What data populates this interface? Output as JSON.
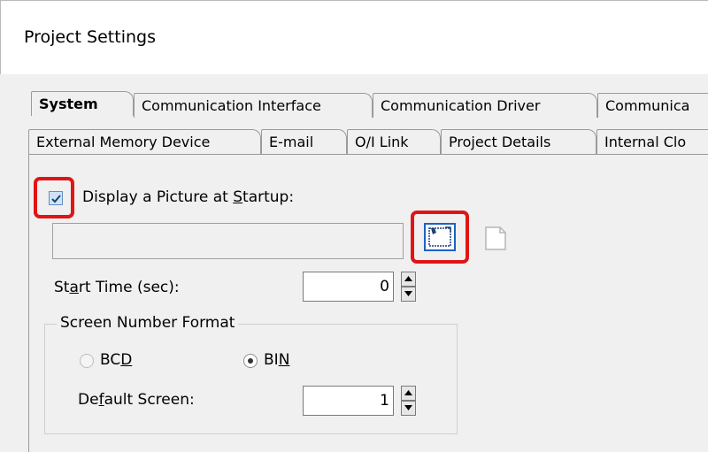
{
  "window": {
    "title": "Project Settings"
  },
  "tabs": {
    "row1": [
      "System",
      "Communication Interface",
      "Communication Driver",
      "Communica"
    ],
    "row2": [
      "External Memory Device",
      "E-mail",
      "O/I Link",
      "Project Details",
      "Internal Clo"
    ],
    "active": "System"
  },
  "startup_picture": {
    "checkbox_checked": true,
    "label_pre": "Display a Picture at ",
    "label_u": "S",
    "label_post": "tartup:",
    "path_value": ""
  },
  "start_time": {
    "label_pre": "St",
    "label_u": "a",
    "label_post": "rt Time (sec):",
    "value": "0"
  },
  "screen_number_format": {
    "legend": "Screen Number Format",
    "bcd": {
      "pre": "BC",
      "u": "D",
      "selected": false,
      "enabled": false
    },
    "bin": {
      "pre": "BI",
      "u": "N",
      "selected": true,
      "enabled": true
    },
    "selected": "BIN"
  },
  "default_screen": {
    "label_pre": "De",
    "label_u": "f",
    "label_post": "ault Screen:",
    "value": "1"
  },
  "icons": {
    "checkbox": "checkmark-icon",
    "browse": "open-file-icon",
    "clear": "blank-file-icon",
    "spin_up": "triangle-up-icon",
    "spin_down": "triangle-down-icon"
  },
  "colors": {
    "highlight": "#e01515",
    "dialog_bg": "#f0f0f0",
    "checkbox_fill": "#cfe3f7"
  }
}
